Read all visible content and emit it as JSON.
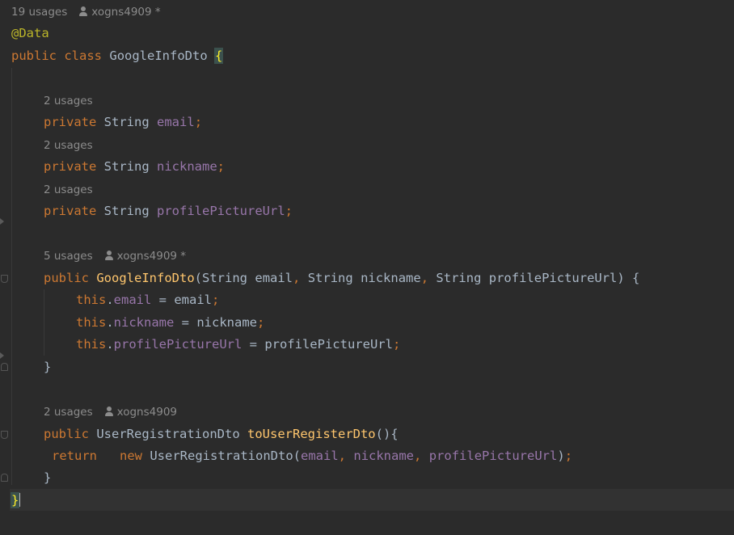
{
  "class_hint": {
    "usages": "19 usages",
    "author": "xogns4909 *"
  },
  "annotation": "@Data",
  "class_decl": {
    "kw_public": "public",
    "kw_class": "class",
    "name": "GoogleInfoDto",
    "open": "{"
  },
  "fields": [
    {
      "usages": "2 usages",
      "kw": "private",
      "type": "String",
      "name": "email",
      "semi": ";"
    },
    {
      "usages": "2 usages",
      "kw": "private",
      "type": "String",
      "name": "nickname",
      "semi": ";"
    },
    {
      "usages": "2 usages",
      "kw": "private",
      "type": "String",
      "name": "profilePictureUrl",
      "semi": ";"
    }
  ],
  "constructor": {
    "usages": "5 usages",
    "author": "xogns4909 *",
    "kw_public": "public",
    "name": "GoogleInfoDto",
    "params_open": "(",
    "p1_type": "String",
    "p1_name": "email",
    "comma1": ",",
    "p2_type": "String",
    "p2_name": "nickname",
    "comma2": ",",
    "p3_type": "String",
    "p3_name": "profilePictureUrl",
    "params_close": ") {",
    "body": [
      {
        "this": "this",
        "dot": ".",
        "field": "email",
        "assign": " = ",
        "value": "email",
        "semi": ";"
      },
      {
        "this": "this",
        "dot": ".",
        "field": "nickname",
        "assign": " = ",
        "value": "nickname",
        "semi": ";"
      },
      {
        "this": "this",
        "dot": ".",
        "field": "profilePictureUrl",
        "assign": " = ",
        "value": "profilePictureUrl",
        "semi": ";"
      }
    ],
    "close": "}"
  },
  "method": {
    "usages": "2 usages",
    "author": "xogns4909",
    "kw_public": "public",
    "return_type": "UserRegistrationDto",
    "name": "toUserRegisterDto",
    "signature_end": "(){",
    "kw_return": "return",
    "kw_new": "new",
    "ctor": "UserRegistrationDto",
    "args_open": "(",
    "a1": "email",
    "c1": ",",
    "a2": "nickname",
    "c2": ",",
    "a3": "profilePictureUrl",
    "args_close": ")",
    "semi": ";",
    "close": "}"
  },
  "class_close": "}"
}
